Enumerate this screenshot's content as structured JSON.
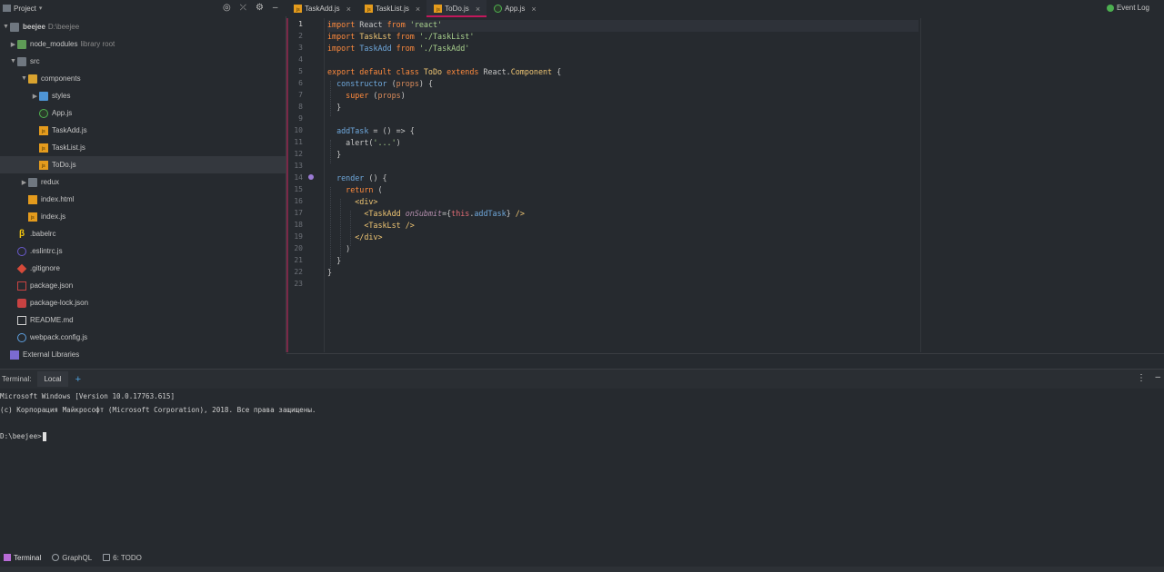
{
  "project_panel": {
    "title": "Project",
    "tree": [
      {
        "label": "beejee",
        "sub": "D:\\beejee",
        "icon": "folder-icon",
        "depth": 0,
        "arrow": "down",
        "bold": true
      },
      {
        "label": "node_modules",
        "sub": "library root",
        "icon": "folder-green-icon",
        "depth": 1,
        "arrow": "right"
      },
      {
        "label": "src",
        "icon": "folder-icon",
        "depth": 1,
        "arrow": "down"
      },
      {
        "label": "components",
        "icon": "folder-yellow-icon",
        "depth": 2,
        "arrow": "down"
      },
      {
        "label": "styles",
        "icon": "folder-blue-icon",
        "depth": 3,
        "arrow": "right"
      },
      {
        "label": "App.js",
        "icon": "react-icon",
        "depth": 3
      },
      {
        "label": "TaskAdd.js",
        "icon": "js-file-icon",
        "depth": 3
      },
      {
        "label": "TaskList.js",
        "icon": "js-file-icon",
        "depth": 3
      },
      {
        "label": "ToDo.js",
        "icon": "js-file-icon",
        "depth": 3,
        "selected": true
      },
      {
        "label": "redux",
        "icon": "folder-icon",
        "depth": 2,
        "arrow": "right"
      },
      {
        "label": "index.html",
        "icon": "html-file-icon",
        "depth": 2
      },
      {
        "label": "index.js",
        "icon": "js-file-icon",
        "depth": 2
      },
      {
        "label": ".babelrc",
        "icon": "babel-icon",
        "depth": 1
      },
      {
        "label": ".eslintrc.js",
        "icon": "eslint-icon",
        "depth": 1
      },
      {
        "label": ".gitignore",
        "icon": "git-icon",
        "depth": 1
      },
      {
        "label": "package.json",
        "icon": "npm-icon",
        "depth": 1
      },
      {
        "label": "package-lock.json",
        "icon": "lock-icon",
        "depth": 1
      },
      {
        "label": "README.md",
        "icon": "markdown-icon",
        "depth": 1
      },
      {
        "label": "webpack.config.js",
        "icon": "webpack-icon",
        "depth": 1
      },
      {
        "label": "External Libraries",
        "icon": "libraries-icon",
        "depth": 0
      }
    ]
  },
  "editor": {
    "tabs": [
      {
        "label": "TaskAdd.js",
        "active": false
      },
      {
        "label": "TaskList.js",
        "active": false
      },
      {
        "label": "ToDo.js",
        "active": true
      },
      {
        "label": "App.js",
        "active": false
      }
    ],
    "current_line": 1,
    "lines": [
      [
        [
          "kw",
          "import"
        ],
        [
          "t",
          " React "
        ],
        [
          "kw",
          "from"
        ],
        [
          "t",
          " "
        ],
        [
          "str",
          "'react'"
        ]
      ],
      [
        [
          "kw",
          "import"
        ],
        [
          "t",
          " "
        ],
        [
          "cls",
          "TaskLst"
        ],
        [
          "t",
          " "
        ],
        [
          "kw",
          "from"
        ],
        [
          "t",
          " "
        ],
        [
          "str",
          "'./TaskList'"
        ]
      ],
      [
        [
          "kw",
          "import"
        ],
        [
          "t",
          " "
        ],
        [
          "fn",
          "TaskAdd"
        ],
        [
          "t",
          " "
        ],
        [
          "kw",
          "from"
        ],
        [
          "t",
          " "
        ],
        [
          "str",
          "'./TaskAdd'"
        ]
      ],
      [],
      [
        [
          "kw",
          "export default class"
        ],
        [
          "t",
          " "
        ],
        [
          "cls",
          "ToDo"
        ],
        [
          "t",
          " "
        ],
        [
          "kw",
          "extends"
        ],
        [
          "t",
          " React."
        ],
        [
          "cls",
          "Component"
        ],
        [
          "t",
          " {"
        ]
      ],
      [
        [
          "t",
          "  "
        ],
        [
          "fn",
          "constructor"
        ],
        [
          "t",
          " ("
        ],
        [
          "par",
          "props"
        ],
        [
          "t",
          ") {"
        ]
      ],
      [
        [
          "t",
          "    "
        ],
        [
          "kw",
          "super"
        ],
        [
          "t",
          " ("
        ],
        [
          "par",
          "props"
        ],
        [
          "t",
          ")"
        ]
      ],
      [
        [
          "t",
          "  }"
        ]
      ],
      [],
      [
        [
          "t",
          "  "
        ],
        [
          "fn",
          "addTask"
        ],
        [
          "t",
          " = () => {"
        ]
      ],
      [
        [
          "t",
          "    alert("
        ],
        [
          "str",
          "'...'"
        ],
        [
          "t",
          ")"
        ]
      ],
      [
        [
          "t",
          "  }"
        ]
      ],
      [],
      [
        [
          "t",
          "  "
        ],
        [
          "fn",
          "render"
        ],
        [
          "t",
          " () {"
        ]
      ],
      [
        [
          "t",
          "    "
        ],
        [
          "kw",
          "return"
        ],
        [
          "t",
          " ("
        ]
      ],
      [
        [
          "t",
          "      "
        ],
        [
          "tag",
          "<div>"
        ]
      ],
      [
        [
          "t",
          "        "
        ],
        [
          "tag",
          "<TaskAdd"
        ],
        [
          "t",
          " "
        ],
        [
          "attr",
          "onSubmit"
        ],
        [
          "t",
          "={"
        ],
        [
          "thisk",
          "this"
        ],
        [
          "t",
          "."
        ],
        [
          "fn",
          "addTask"
        ],
        [
          "t",
          "} "
        ],
        [
          "tag",
          "/>"
        ]
      ],
      [
        [
          "t",
          "        "
        ],
        [
          "tag",
          "<TaskLst"
        ],
        [
          "t",
          " "
        ],
        [
          "tag",
          "/>"
        ]
      ],
      [
        [
          "t",
          "      "
        ],
        [
          "tag",
          "</div>"
        ]
      ],
      [
        [
          "t",
          "    )"
        ]
      ],
      [
        [
          "t",
          "  }"
        ]
      ],
      [
        [
          "t",
          "}"
        ]
      ],
      []
    ]
  },
  "terminal": {
    "label": "Terminal:",
    "tab": "Local",
    "add": "+",
    "lines": [
      "Microsoft Windows [Version 10.0.17763.615]",
      "(c) Корпорация Майкрософт (Microsoft Corporation), 2018. Все права защищены.",
      "",
      "D:\\beejee>"
    ]
  },
  "status_bar": {
    "items": [
      {
        "label": "Terminal",
        "icon": "terminal-icon",
        "active": true
      },
      {
        "label": "GraphQL",
        "icon": "graphql-icon"
      },
      {
        "label": "6: TODO",
        "icon": "todo-icon"
      }
    ],
    "event_log": "Event Log"
  },
  "colors": {
    "background": "#262a2f",
    "accent": "#c2185b",
    "keyword": "#ff8a3d",
    "string": "#a9d18e"
  }
}
